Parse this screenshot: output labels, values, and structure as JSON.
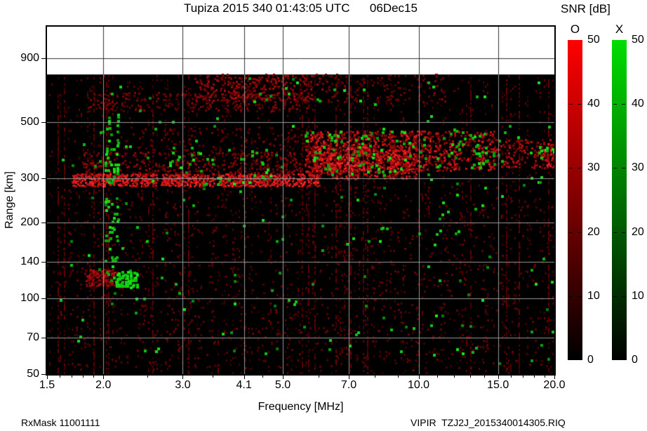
{
  "header": {
    "title": "Tupiza 2015 340 01:43:05 UTC      06Dec15"
  },
  "footer": {
    "rx_mask": "RxMask 11001111",
    "file": "VIPIR  TZJ2J_2015340014305.RIQ"
  },
  "chart_data": {
    "type": "heatmap",
    "title": "Tupiza 2015 340 01:43:05 UTC      06Dec15",
    "xlabel": "Frequency [MHz]",
    "ylabel": "Range [km]",
    "x_scale": "log",
    "y_scale": "log",
    "xlim": [
      1.5,
      20
    ],
    "ylim": [
      50,
      1200
    ],
    "data_top_km": 775,
    "x_ticks": [
      1.5,
      2.0,
      3.0,
      4.1,
      5.0,
      7.0,
      10.0,
      15.0,
      20.0
    ],
    "x_tick_labels": [
      "1.5",
      "2.0",
      "3.0",
      "4.1",
      "5.0",
      "7.0",
      "10.0",
      "15.0",
      "20.0"
    ],
    "x_minor_ticks": [
      1.6,
      1.7,
      1.8,
      1.9,
      2.5,
      3.5,
      4.5,
      6.0,
      8.0,
      9.0,
      11,
      12,
      13,
      14,
      16,
      17,
      18,
      19
    ],
    "y_ticks": [
      900,
      500,
      300,
      200,
      140,
      100,
      70,
      50
    ],
    "y_tick_labels": [
      "900",
      "500",
      "300",
      "200",
      "140",
      "100",
      "70",
      "50"
    ],
    "gridlines": {
      "x": [
        2.0,
        3.0,
        4.1,
        5.0,
        7.0,
        10.0,
        15.0
      ],
      "y": [
        900,
        500,
        300,
        200,
        140,
        100,
        70
      ]
    },
    "grid_color_on_data": "#999999",
    "grid_color_on_white": "#333333",
    "colorbar": {
      "title": "SNR [dB]",
      "o_label": "O",
      "x_label": "X",
      "min": 0,
      "max": 50,
      "ticks": [
        50,
        40,
        30,
        20,
        10,
        0
      ],
      "tick_labels": [
        "50",
        "40",
        "30",
        "20",
        "10",
        "0"
      ],
      "dash_ticks": [
        40,
        30,
        20,
        10
      ],
      "o_top_color": "#ff0000",
      "x_top_color": "#00dd00",
      "bottom_color": "#000000"
    },
    "background": {
      "fill": "#000000",
      "speckle": "dim red vertical striping",
      "streak_chance": 0.07
    },
    "features": [
      {
        "name": "f-trace-core",
        "mode": "O",
        "f": [
          1.7,
          6.0
        ],
        "r": [
          283,
          312
        ],
        "density": 0.92,
        "intensity": [
          0.55,
          1.0
        ]
      },
      {
        "name": "f-trace-glow",
        "mode": "O",
        "f": [
          1.8,
          6.0
        ],
        "r": [
          310,
          380
        ],
        "density": 0.3,
        "intensity": [
          0.15,
          0.5
        ]
      },
      {
        "name": "f-trace-upper-glow",
        "mode": "O",
        "f": [
          2.2,
          6.0
        ],
        "r": [
          380,
          480
        ],
        "density": 0.12,
        "intensity": [
          0.1,
          0.35
        ]
      },
      {
        "name": "spread-f-mid",
        "mode": "O",
        "f": [
          5.6,
          9.8
        ],
        "r": [
          300,
          460
        ],
        "density": 0.5,
        "intensity": [
          0.25,
          0.9
        ]
      },
      {
        "name": "spread-f-mid-core",
        "mode": "O",
        "f": [
          5.8,
          9.6
        ],
        "r": [
          320,
          400
        ],
        "density": 0.55,
        "intensity": [
          0.4,
          1.0
        ]
      },
      {
        "name": "spread-f-high",
        "mode": "O",
        "f": [
          9.8,
          14.6
        ],
        "r": [
          320,
          460
        ],
        "density": 0.42,
        "intensity": [
          0.25,
          0.85
        ]
      },
      {
        "name": "spread-f-far",
        "mode": "O",
        "f": [
          14.6,
          20.0
        ],
        "r": [
          330,
          430
        ],
        "density": 0.33,
        "intensity": [
          0.2,
          0.7
        ]
      },
      {
        "name": "right-edge-blob",
        "mode": "O",
        "f": [
          18.8,
          20.0
        ],
        "r": [
          330,
          410
        ],
        "density": 0.6,
        "intensity": [
          0.4,
          0.95
        ]
      },
      {
        "name": "second-hop-band",
        "mode": "O",
        "f": [
          1.85,
          5.6
        ],
        "r": [
          555,
          655
        ],
        "density": 0.28,
        "intensity": [
          0.12,
          0.45
        ]
      },
      {
        "name": "second-hop-blob",
        "mode": "O",
        "f": [
          3.2,
          6.1
        ],
        "r": [
          615,
          775
        ],
        "density": 0.38,
        "intensity": [
          0.2,
          0.6
        ]
      },
      {
        "name": "second-hop-right",
        "mode": "O",
        "f": [
          6.2,
          12.0
        ],
        "r": [
          600,
          775
        ],
        "density": 0.15,
        "intensity": [
          0.1,
          0.4
        ]
      },
      {
        "name": "es-patch",
        "mode": "O",
        "f": [
          1.82,
          2.15
        ],
        "r": [
          112,
          130
        ],
        "density": 0.75,
        "intensity": [
          0.25,
          0.7
        ]
      },
      {
        "name": "low-diffuse",
        "mode": "O",
        "f": [
          1.6,
          20.0
        ],
        "r": [
          52,
          280
        ],
        "density": 0.05,
        "intensity": [
          0.05,
          0.3
        ]
      },
      {
        "name": "x-global-sparse",
        "mode": "X",
        "f": [
          1.6,
          20.0
        ],
        "r": [
          55,
          770
        ],
        "density": 0.012,
        "intensity": [
          0.35,
          1.0
        ]
      },
      {
        "name": "x-trace-cluster",
        "mode": "X",
        "f": [
          2.8,
          4.7
        ],
        "r": [
          285,
          400
        ],
        "density": 0.07,
        "intensity": [
          0.5,
          1.0
        ]
      },
      {
        "name": "x-mid-cluster",
        "mode": "X",
        "f": [
          5.6,
          9.7
        ],
        "r": [
          310,
          460
        ],
        "density": 0.1,
        "intensity": [
          0.5,
          1.0
        ]
      },
      {
        "name": "x-high-cluster",
        "mode": "X",
        "f": [
          9.9,
          14.2
        ],
        "r": [
          330,
          470
        ],
        "density": 0.09,
        "intensity": [
          0.5,
          1.0
        ]
      },
      {
        "name": "x-far-sparse",
        "mode": "X",
        "f": [
          14.2,
          20.0
        ],
        "r": [
          340,
          450
        ],
        "density": 0.04,
        "intensity": [
          0.4,
          1.0
        ]
      },
      {
        "name": "x-right-line",
        "mode": "X",
        "f": [
          18.4,
          20.0
        ],
        "r": [
          378,
          402
        ],
        "density": 0.45,
        "intensity": [
          0.6,
          1.0
        ]
      },
      {
        "name": "x-streak-2mhz",
        "mode": "X",
        "f": [
          2.02,
          2.14
        ],
        "r": [
          110,
          540
        ],
        "density": 0.22,
        "intensity": [
          0.5,
          1.0
        ]
      },
      {
        "name": "x-es-blob",
        "mode": "X",
        "f": [
          2.13,
          2.38
        ],
        "r": [
          112,
          128
        ],
        "density": 0.9,
        "intensity": [
          0.7,
          1.0
        ]
      },
      {
        "name": "x-second-hop",
        "mode": "X",
        "f": [
          3.9,
          6.6
        ],
        "r": [
          590,
          770
        ],
        "density": 0.03,
        "intensity": [
          0.4,
          0.9
        ]
      }
    ]
  }
}
